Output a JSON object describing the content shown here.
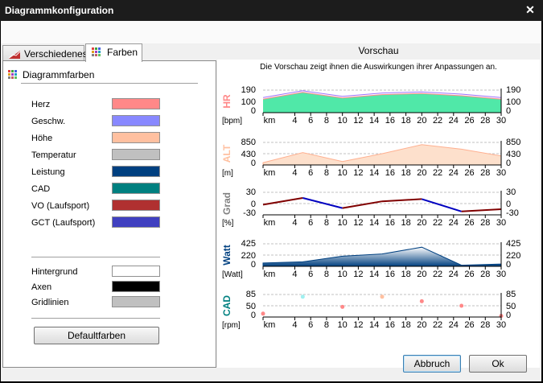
{
  "window": {
    "title": "Diagrammkonfiguration"
  },
  "tabs": [
    {
      "label": "Verschiedenes",
      "active": false,
      "icon": "chart-icon"
    },
    {
      "label": "Farben",
      "active": true,
      "icon": "palette-icon"
    }
  ],
  "colors_panel": {
    "header": "Diagrammfarben",
    "series_colors": [
      {
        "label": "Herz",
        "color": "#ff8888"
      },
      {
        "label": "Geschw.",
        "color": "#8888ff"
      },
      {
        "label": "Höhe",
        "color": "#ffc0a0"
      },
      {
        "label": "Temperatur",
        "color": "#c0c0c0"
      },
      {
        "label": "Leistung",
        "color": "#004080"
      },
      {
        "label": "CAD",
        "color": "#008080"
      },
      {
        "label": "VO (Laufsport)",
        "color": "#b03030"
      },
      {
        "label": "GCT (Laufsport)",
        "color": "#4040c0"
      }
    ],
    "base_colors": [
      {
        "label": "Hintergrund",
        "color": "#ffffff"
      },
      {
        "label": "Axen",
        "color": "#000000"
      },
      {
        "label": "Gridlinien",
        "color": "#c0c0c0"
      }
    ],
    "default_button": "Defaultfarben"
  },
  "preview": {
    "header": "Vorschau",
    "subtitle": "Die Vorschau zeigt ihnen die Auswirkungen ihrer Anpassungen an.",
    "x_ticks": [
      "km",
      "4",
      "6",
      "8",
      "10",
      "12",
      "14",
      "16",
      "18",
      "20",
      "22",
      "24",
      "26",
      "28",
      "30"
    ],
    "charts": [
      {
        "title": "HR",
        "unit": "[bpm]",
        "ticks": [
          "190",
          "100",
          "0"
        ],
        "color": "#ff8888"
      },
      {
        "title": "ALT",
        "unit": "[m]",
        "ticks": [
          "850",
          "430",
          "0"
        ],
        "color": "#ffc0a0"
      },
      {
        "title": "Grad",
        "unit": "[%]",
        "ticks": [
          "30",
          "0",
          "-30"
        ],
        "color": "#808080"
      },
      {
        "title": "Watt",
        "unit": "[Watt]",
        "ticks": [
          "425",
          "220",
          "0"
        ],
        "color": "#004080"
      },
      {
        "title": "CAD",
        "unit": "[rpm]",
        "ticks": [
          "85",
          "50",
          "0"
        ],
        "color": "#008080"
      }
    ]
  },
  "buttons": {
    "cancel": "Abbruch",
    "ok": "Ok"
  }
}
